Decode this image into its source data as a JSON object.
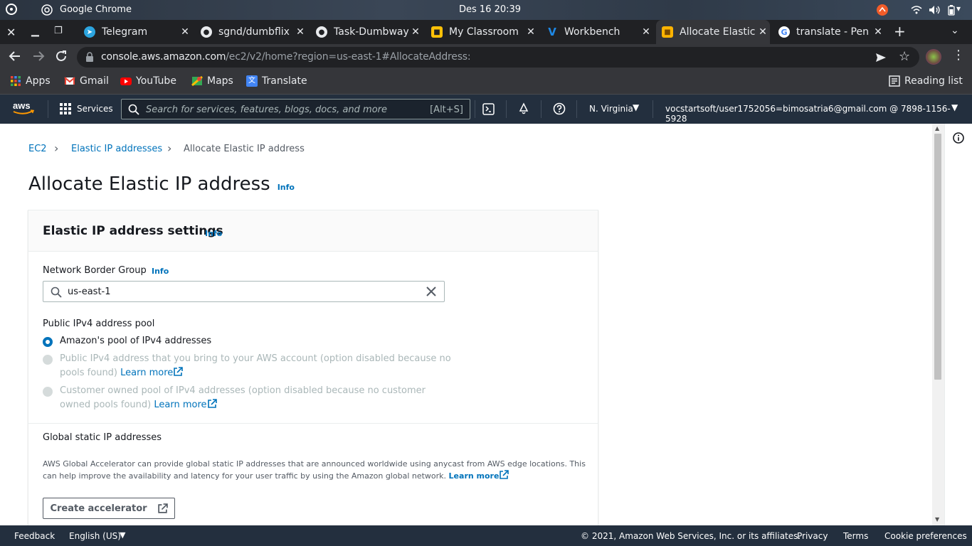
{
  "os": {
    "app_label": "Google Chrome",
    "clock": "Des 16  20:39"
  },
  "tabs": [
    {
      "label": "Telegram",
      "icon": "telegram-icon",
      "color": "#2ca5e0"
    },
    {
      "label": "sgnd/dumbflix",
      "icon": "github-icon",
      "color": "#e8eaed"
    },
    {
      "label": "Task-Dumbways",
      "icon": "github-icon",
      "color": "#e8eaed"
    },
    {
      "label": "My Classroom",
      "icon": "classroom-icon",
      "color": "#ffc107"
    },
    {
      "label": "Workbench",
      "icon": "vocareum-icon",
      "color": "#1e88e5"
    },
    {
      "label": "Allocate Elastic IP",
      "icon": "aws-cube-icon",
      "color": "#ffb300"
    },
    {
      "label": "translate - Pen",
      "icon": "google-icon",
      "color": "#ffffff"
    }
  ],
  "address_bar": {
    "host": "console.aws.amazon.com",
    "path": "/ec2/v2/home?region=us-east-1#AllocateAddress:"
  },
  "bookmarks": [
    {
      "label": "Apps",
      "icon": "apps-grid-icon"
    },
    {
      "label": "Gmail",
      "icon": "gmail-icon"
    },
    {
      "label": "YouTube",
      "icon": "youtube-icon"
    },
    {
      "label": "Maps",
      "icon": "maps-icon"
    },
    {
      "label": "Translate",
      "icon": "translate-icon"
    }
  ],
  "reading_list": "Reading list",
  "aws_nav": {
    "logo": "aws",
    "services": "Services",
    "search_placeholder": "Search for services, features, blogs, docs, and more",
    "search_shortcut": "[Alt+S]",
    "region": "N. Virginia",
    "account": "vocstartsoft/user1752056=bimosatria6@gmail.com @ 7898-1156-5928"
  },
  "breadcrumb": [
    "EC2",
    "Elastic IP addresses",
    "Allocate Elastic IP address"
  ],
  "page_title": "Allocate Elastic IP address",
  "info_label": "Info",
  "panel": {
    "title": "Elastic IP address settings",
    "network_border_group_label": "Network Border Group",
    "network_border_group_value": "us-east-1",
    "pool_label": "Public IPv4 address pool",
    "options": [
      {
        "line1": "Amazon's pool of IPv4 addresses",
        "line2": "",
        "link": "",
        "selected": true,
        "disabled": false
      },
      {
        "line1": "Public IPv4 address that you bring to your AWS account (option disabled because no",
        "line2": "pools found)",
        "link": "Learn more",
        "selected": false,
        "disabled": true
      },
      {
        "line1": "Customer owned pool of IPv4 addresses (option disabled because no customer",
        "line2": "owned pools found)",
        "link": "Learn more",
        "selected": false,
        "disabled": true
      }
    ],
    "global_title": "Global static IP addresses",
    "global_desc_1": "AWS Global Accelerator can provide global static IP addresses that are announced worldwide using anycast from AWS edge locations. This",
    "global_desc_2": "can help improve the availability and latency for your user traffic by using the Amazon global network.",
    "global_link": "Learn more",
    "create_button": "Create accelerator"
  },
  "footer": {
    "feedback": "Feedback",
    "language": "English (US)",
    "copyright": "© 2021, Amazon Web Services, Inc. or its affiliates.",
    "privacy": "Privacy",
    "terms": "Terms",
    "cookies": "Cookie preferences"
  },
  "colors": {
    "aws_nav": "#232f3e",
    "link": "#0073bb",
    "aws_orange": "#ff9900"
  }
}
